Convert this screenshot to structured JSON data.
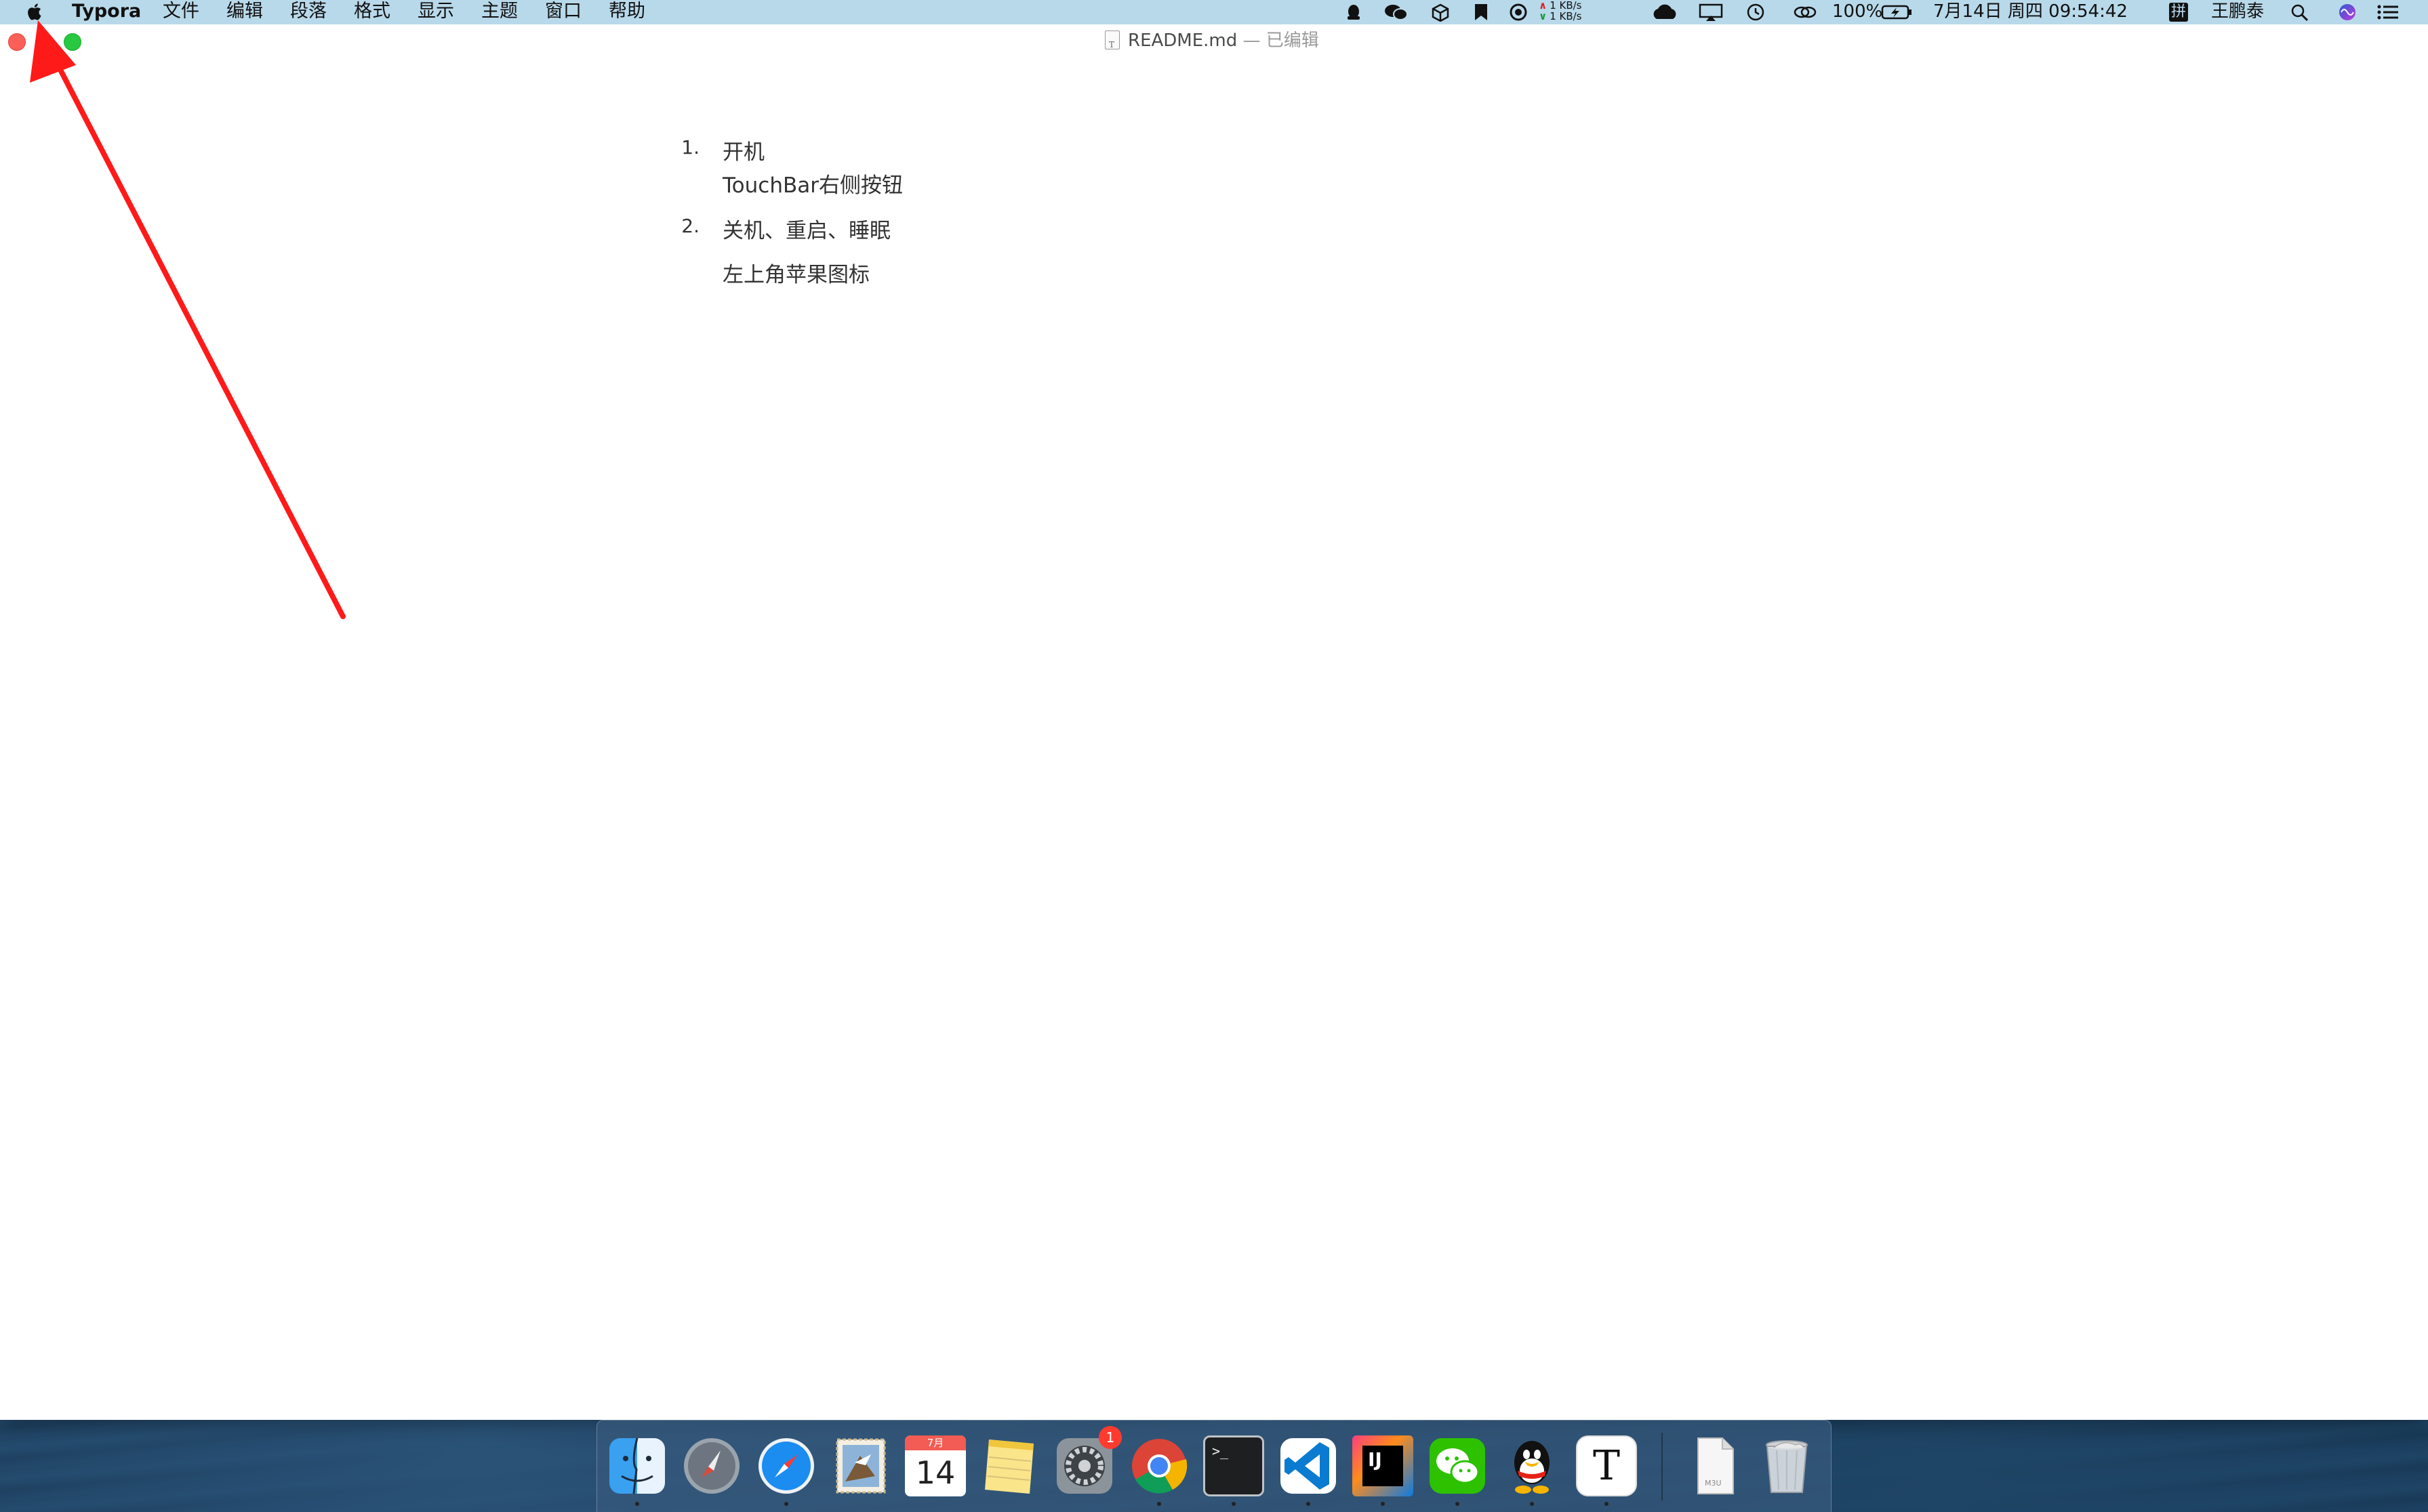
{
  "menubar": {
    "app_name": "Typora",
    "items": [
      "文件",
      "编辑",
      "段落",
      "格式",
      "显示",
      "主题",
      "窗口",
      "帮助"
    ],
    "status": {
      "net_up": "1 KB/s",
      "net_down": "1 KB/s",
      "battery": "100%",
      "datetime": "7月14日 周四  09:54:42",
      "input_method": "拼",
      "user": "王鹏泰"
    },
    "icons": [
      "apple-icon",
      "qq-tray-icon",
      "wechat-tray-icon",
      "box-tray-icon",
      "bookmark-tray-icon",
      "activity-tray-icon",
      "cloud-tray-icon",
      "airplay-icon",
      "time-machine-icon",
      "controller-icon",
      "battery-icon",
      "spotlight-icon",
      "siri-icon",
      "notification-center-icon"
    ]
  },
  "window": {
    "title": "README.md",
    "status": "— 已编辑"
  },
  "document": {
    "list": [
      {
        "number": "1.",
        "title": "开机",
        "detail": "TouchBar右侧按钮"
      },
      {
        "number": "2.",
        "title": "关机、重启、睡眠",
        "detail": "左上角苹果图标"
      }
    ]
  },
  "annotation": {
    "arrow_color": "#ff1a1a"
  },
  "dock": {
    "apps": [
      "finder-icon",
      "launchpad-icon",
      "safari-icon",
      "mail-icon",
      "calendar-icon",
      "notes-icon",
      "system-preferences-icon",
      "chrome-icon",
      "terminal-icon",
      "vscode-icon",
      "intellij-icon",
      "wechat-icon",
      "qq-icon",
      "typora-icon",
      "document-icon",
      "trash-icon"
    ],
    "calendar_month": "7月",
    "calendar_day": "14",
    "prefs_badge": "1",
    "intellij_label": "IJ",
    "typora_label": "T",
    "terminal_prompt": ">_",
    "doc_label": "M3U"
  }
}
